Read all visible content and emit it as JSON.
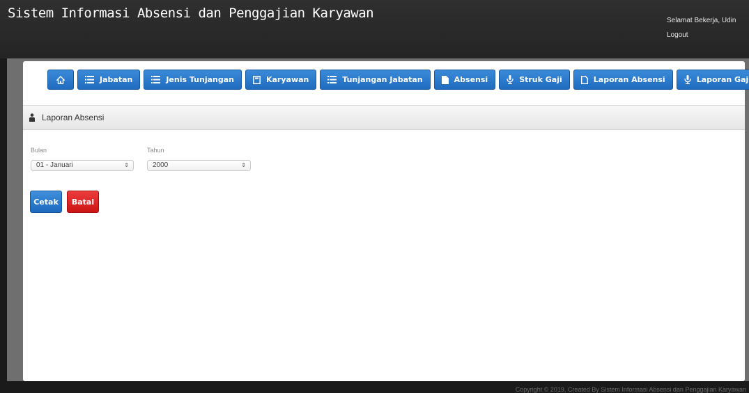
{
  "header": {
    "title": "Sistem Informasi Absensi dan Penggajian Karyawan",
    "greeting": "Selamat Bekerja, Udin",
    "logout_label": "Logout"
  },
  "nav": {
    "items": [
      {
        "label": "",
        "icon": "home-icon"
      },
      {
        "label": "Jabatan",
        "icon": "list-icon"
      },
      {
        "label": "Jenis Tunjangan",
        "icon": "list-icon"
      },
      {
        "label": "Karyawan",
        "icon": "book-icon"
      },
      {
        "label": "Tunjangan Jabatan",
        "icon": "list-icon"
      },
      {
        "label": "Absensi",
        "icon": "file-icon"
      },
      {
        "label": "Struk Gaji",
        "icon": "microphone-icon"
      },
      {
        "label": "Laporan Absensi",
        "icon": "file-outline-icon"
      },
      {
        "label": "Laporan Gaji",
        "icon": "microphone-icon"
      }
    ]
  },
  "section": {
    "title": "Laporan Absensi"
  },
  "form": {
    "month_label": "Bulan",
    "month_value": "01 - Januari",
    "year_label": "Tahun",
    "year_value": "2000"
  },
  "actions": {
    "print_label": "Cetak",
    "cancel_label": "Batal"
  },
  "footer": {
    "copyright": "Copyright © 2019, Created By Sistem Informasi Absensi dan Penggajian Karyawan"
  },
  "colors": {
    "primary_blue": "#1f6cc0",
    "danger_red": "#cc1515",
    "topbar": "#2a2a2a"
  }
}
